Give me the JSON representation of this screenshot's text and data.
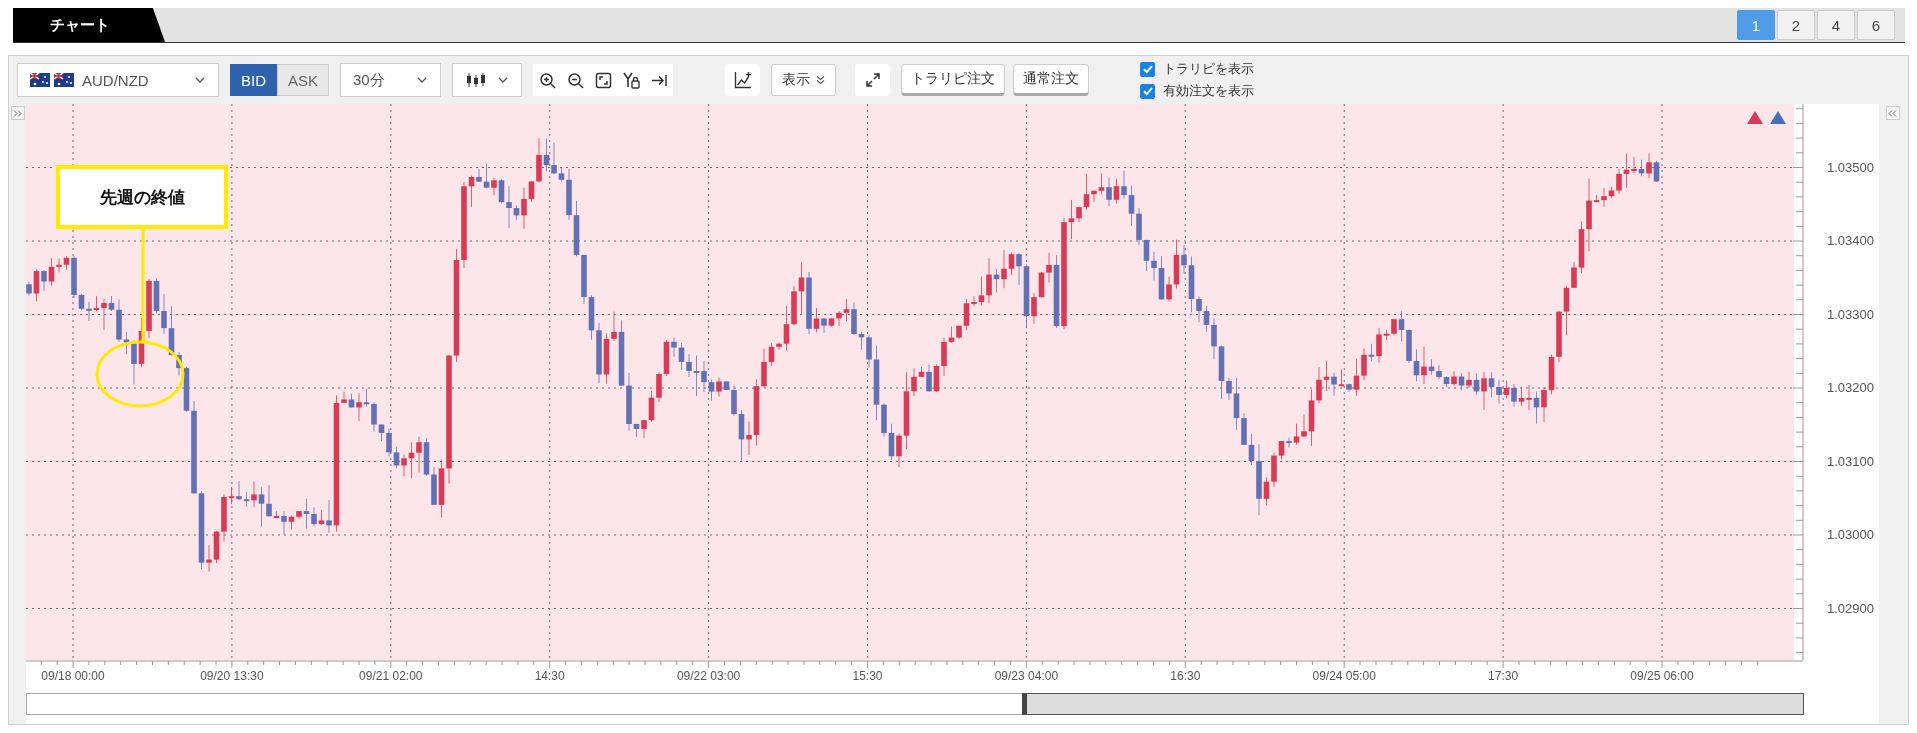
{
  "header": {
    "title_tab": "チャート",
    "layout_buttons": [
      {
        "label": "1",
        "selected": true
      },
      {
        "label": "2",
        "selected": false
      },
      {
        "label": "4",
        "selected": false
      },
      {
        "label": "6",
        "selected": false
      }
    ]
  },
  "toolbar": {
    "symbol": "AUD/NZD",
    "price_sides": [
      {
        "label": "BID",
        "selected": true
      },
      {
        "label": "ASK",
        "selected": false
      }
    ],
    "timeframe": "30分",
    "display_menu": "表示",
    "order_buttons": [
      "トラリピ注文",
      "通常注文"
    ],
    "checkboxes": [
      {
        "label": "トラリピを表示",
        "checked": true
      },
      {
        "label": "有効注文を表示",
        "checked": true
      }
    ]
  },
  "chart": {
    "y_axis_labels": [
      "1.03500",
      "1.03400",
      "1.03300",
      "1.03200",
      "1.03100",
      "1.03000",
      "1.02900"
    ],
    "x_axis_labels": [
      "09/18 00:00",
      "09/20 13:30",
      "09/21 02:00",
      "14:30",
      "09/22 03:00",
      "15:30",
      "09/23 04:00",
      "16:30",
      "09/24 05:00",
      "17:30",
      "09/25 06:00"
    ],
    "annotation": {
      "text": "先週の終値"
    }
  }
}
